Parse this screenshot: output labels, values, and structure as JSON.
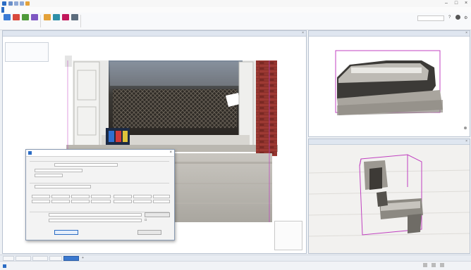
{
  "app": {
    "title": ""
  },
  "menu": {
    "file": "",
    "tabs": [
      "",
      "",
      "",
      "",
      "",
      "",
      ""
    ]
  },
  "ribbon": {
    "tools": [
      {
        "icon": "insert-icon",
        "label": "",
        "color": "#3a7bd5"
      },
      {
        "icon": "attach-icon",
        "label": "",
        "color": "#d9493c"
      },
      {
        "icon": "view-icon",
        "label": "",
        "color": "#4f9a3a"
      },
      {
        "icon": "layers-icon",
        "label": "",
        "color": "#7e57c2"
      },
      {
        "icon": "section-icon",
        "label": "",
        "color": "#e4a23a"
      },
      {
        "icon": "clip-icon",
        "label": "",
        "color": "#2e8fa8"
      },
      {
        "icon": "manage-icon",
        "label": "",
        "color": "#c2185b"
      },
      {
        "icon": "render-icon",
        "label": "",
        "color": "#5d6d7e"
      }
    ],
    "groups": [
      "",
      ""
    ],
    "search_placeholder": ""
  },
  "views": {
    "main_title": "",
    "top_right_title": "",
    "bottom_right_title": "",
    "info_panel": ""
  },
  "dialog": {
    "title": "",
    "section_source": "",
    "label_file": "",
    "field_file": "",
    "label_format": "",
    "section_target": "",
    "field_target": "",
    "columns": [
      "",
      "",
      "",
      "",
      "",
      "",
      ""
    ],
    "row1": [
      "",
      "",
      "",
      "",
      "",
      "",
      ""
    ],
    "row2": [
      "",
      "",
      "",
      "",
      "",
      "",
      ""
    ],
    "label_options": "",
    "label_name": "",
    "field_name": "",
    "label_path": "",
    "field_path": "",
    "browse": "",
    "ok": "",
    "cancel": ""
  },
  "viewcube": {
    "items": [
      "",
      "",
      ""
    ]
  },
  "view_tabs": [
    "",
    "",
    "",
    "",
    ""
  ],
  "status": {
    "left": "",
    "center1": "",
    "center2": "",
    "coords": "",
    "units": "",
    "zoom": ""
  },
  "colors": {
    "accent": "#2b6cc4",
    "brick": "#8b2f2a",
    "section_box": "#c040c0"
  }
}
